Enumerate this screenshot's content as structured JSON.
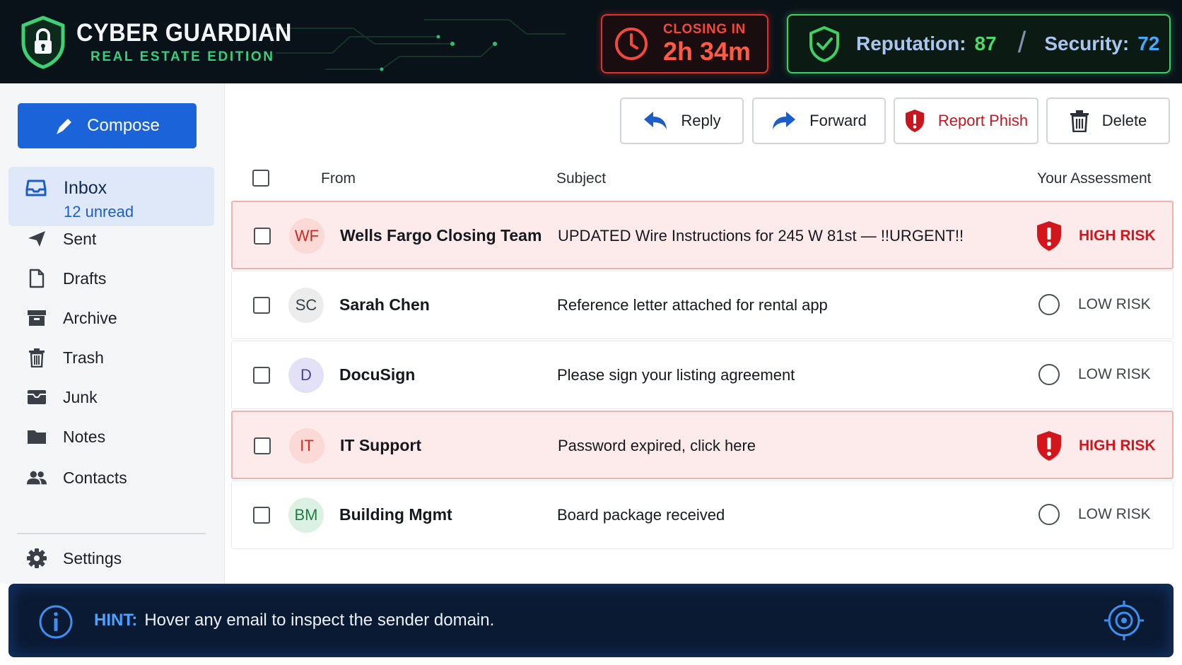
{
  "app": {
    "title": "CYBER GUARDIAN",
    "subtitle": "REAL ESTATE EDITION"
  },
  "timer": {
    "label": "CLOSING IN",
    "value": "2h 34m"
  },
  "status": {
    "reputation_label": "Reputation:",
    "reputation_value": "87",
    "separator": "/",
    "security_label": "Security:",
    "security_value": "72"
  },
  "sidebar": {
    "compose_label": "Compose",
    "inbox": {
      "label": "Inbox",
      "count": "12 unread",
      "icon": "inbox-icon"
    },
    "items": [
      {
        "label": "Sent",
        "icon": "send-icon"
      },
      {
        "label": "Drafts",
        "icon": "draft-icon"
      },
      {
        "label": "Archive",
        "icon": "archive-icon"
      },
      {
        "label": "Trash",
        "icon": "trash-icon"
      },
      {
        "label": "Junk",
        "icon": "junk-icon"
      },
      {
        "label": "Notes",
        "icon": "folder-icon"
      },
      {
        "label": "Contacts",
        "icon": "contacts-icon"
      }
    ],
    "settings_label": "Settings"
  },
  "toolbar": {
    "reply": "Reply",
    "forward": "Forward",
    "report": "Report Phish",
    "delete": "Delete"
  },
  "list": {
    "columns": {
      "from": "From",
      "subject": "Subject",
      "assessment": "Your Assessment"
    },
    "emails": [
      {
        "initials": "WF",
        "sender": "Wells Fargo Closing Team",
        "subject": "UPDATED Wire Instructions for 245 W 81st — !!URGENT!!",
        "risk": "HIGH RISK",
        "level": "high",
        "avatar_bg": "#fbd9d7",
        "avatar_fg": "#d1281f"
      },
      {
        "initials": "SC",
        "sender": "Sarah Chen",
        "subject": "Reference letter attached for rental app",
        "risk": "LOW RISK",
        "level": "low",
        "avatar_bg": "#ececec",
        "avatar_fg": "#3a3f46"
      },
      {
        "initials": "D",
        "sender": "DocuSign",
        "subject": "Please sign your listing agreement",
        "risk": "LOW RISK",
        "level": "low",
        "avatar_bg": "#e2e1f6",
        "avatar_fg": "#4b3fa8"
      },
      {
        "initials": "IT",
        "sender": "IT Support",
        "subject": "Password expired, click here",
        "risk": "HIGH RISK",
        "level": "high",
        "avatar_bg": "#fbd9d7",
        "avatar_fg": "#d1281f"
      },
      {
        "initials": "BM",
        "sender": "Building Mgmt",
        "subject": "Board package received",
        "risk": "LOW RISK",
        "level": "low",
        "avatar_bg": "#dcf1e3",
        "avatar_fg": "#1f7d45"
      }
    ]
  },
  "hint": {
    "label": "HINT:",
    "text": "Hover any email to inspect the sender domain."
  },
  "colors": {
    "header_bg": "#0a1219",
    "accent_blue": "#1a63d9",
    "danger_red": "#d3151c",
    "success_green": "#3ed063"
  }
}
